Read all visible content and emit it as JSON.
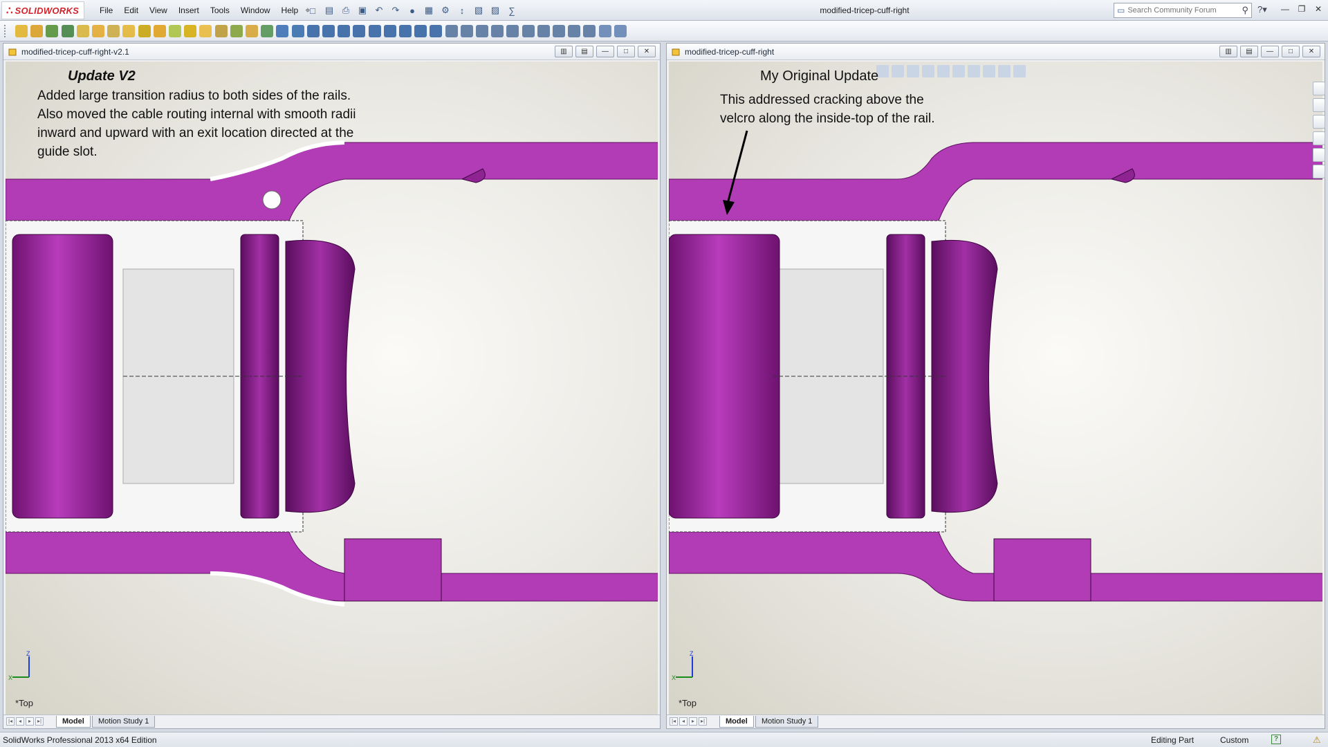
{
  "app": {
    "name": "SOLIDWORKS",
    "document_title": "modified-tricep-cuff-right"
  },
  "menu": [
    "File",
    "Edit",
    "View",
    "Insert",
    "Tools",
    "Window",
    "Help"
  ],
  "search": {
    "placeholder": "Search Community Forum"
  },
  "viewports": {
    "left": {
      "title": "modified-tricep-cuff-right-v2.1",
      "heading": "Update V2",
      "body_lines": [
        "Added large transition radius to both sides of the rails.",
        "Also moved the cable routing internal with smooth radii",
        "inward and upward with an exit location directed at the",
        "guide slot."
      ],
      "view_label": "*Top",
      "tabs": [
        "Model",
        "Motion Study 1"
      ]
    },
    "right": {
      "title": "modified-tricep-cuff-right",
      "heading": "My Original Update",
      "body_lines": [
        "This addressed cracking above the",
        "velcro along the inside-top of the rail."
      ],
      "view_label": "*Top",
      "tabs": [
        "Model",
        "Motion Study 1"
      ]
    }
  },
  "status": {
    "edition": "SolidWorks Professional 2013 x64 Edition",
    "mode": "Editing Part",
    "units": "Custom"
  },
  "colors": {
    "part_magenta": "#b23bb6",
    "part_dark": "#6e1270",
    "canvas_bg": "#e9e7e1",
    "brand_red": "#d2232a"
  },
  "icons": {
    "window_minimize": "minimize-icon",
    "window_restore": "restore-icon",
    "window_close": "close-icon"
  }
}
